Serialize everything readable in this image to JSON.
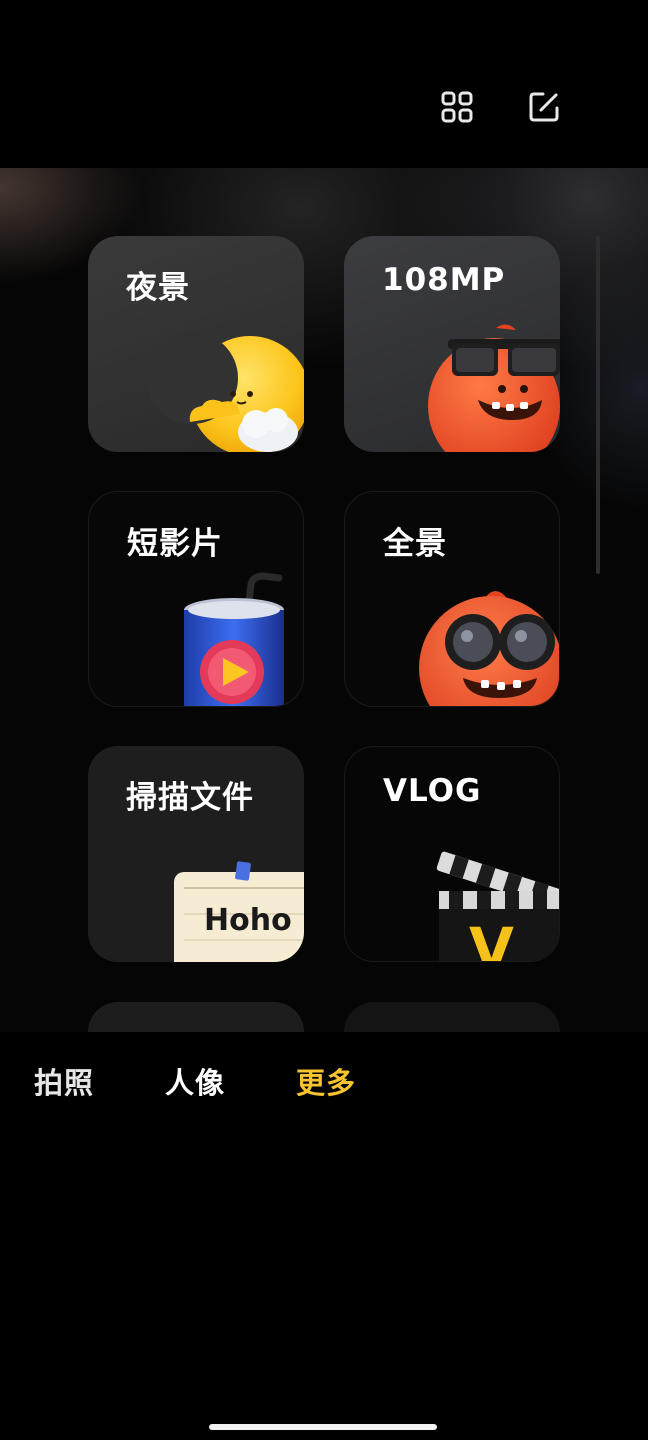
{
  "top_bar": {
    "icons": [
      "grid-icon",
      "edit-icon"
    ]
  },
  "cards": [
    {
      "label": "夜景",
      "art": "moon-mascot"
    },
    {
      "label": "108MP",
      "art": "sunglasses-monster"
    },
    {
      "label": "短影片",
      "art": "video-can"
    },
    {
      "label": "全景",
      "art": "binocular-monster"
    },
    {
      "label": "掃描文件",
      "art": "note-paper",
      "note_text": "Hoho"
    },
    {
      "label": "VLOG",
      "art": "clapperboard",
      "clapper_letter": "V"
    }
  ],
  "mode_bar": {
    "modes": [
      "拍照",
      "人像",
      "更多"
    ],
    "active": "更多"
  },
  "colors": {
    "active_mode": "#f7c430",
    "background": "#000000"
  }
}
